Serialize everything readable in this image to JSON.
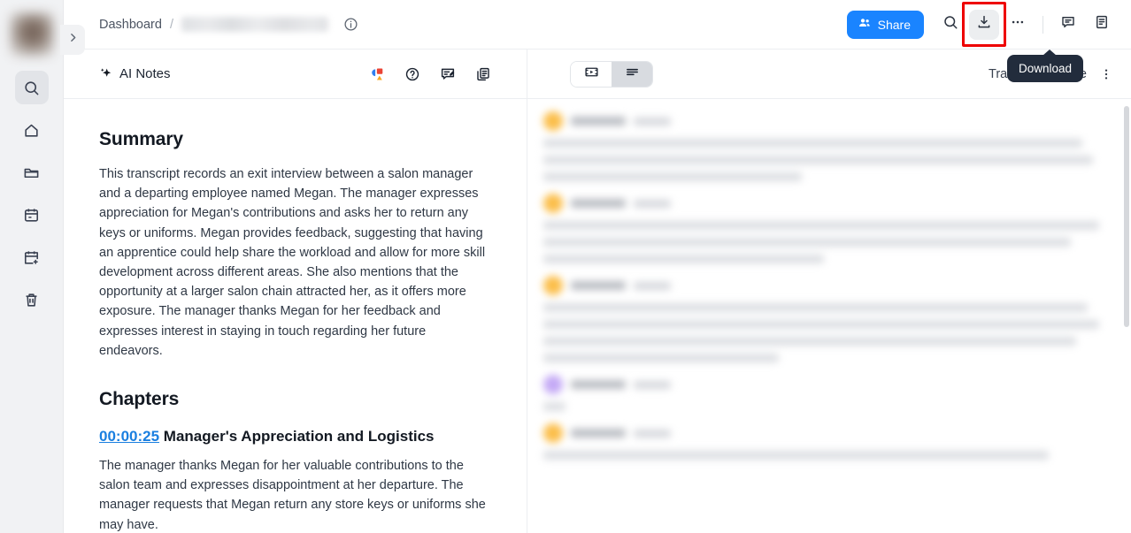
{
  "sidebar": {
    "avatar_label": "user-avatar",
    "items": [
      {
        "name": "search",
        "label": "Search",
        "active": true
      },
      {
        "name": "home",
        "label": "Home",
        "active": false
      },
      {
        "name": "folder",
        "label": "Folder",
        "active": false
      },
      {
        "name": "calendar",
        "label": "Calendar",
        "active": false
      },
      {
        "name": "calendar-add",
        "label": "Schedule",
        "active": false
      },
      {
        "name": "trash",
        "label": "Trash",
        "active": false
      }
    ],
    "expand_icon": "chevron-right-icon"
  },
  "topbar": {
    "breadcrumb_root": "Dashboard",
    "breadcrumb_separator": "/",
    "breadcrumb_current": "",
    "info_icon": "info-circle-icon",
    "share_label": "Share",
    "share_color": "#1a84ff",
    "icons": [
      {
        "name": "search-icon",
        "label": "Search"
      },
      {
        "name": "download-icon",
        "label": "Download",
        "highlighted": true
      },
      {
        "name": "more-horizontal-icon",
        "label": "More options"
      },
      {
        "name": "comment-icon",
        "label": "Comments"
      },
      {
        "name": "notes-icon",
        "label": "Notes"
      }
    ],
    "tooltip": "Download",
    "tooltip_bg": "#222c3c",
    "highlight_color": "#ee0000"
  },
  "notes_panel": {
    "title": "AI Notes",
    "title_icon": "sparkle-icon",
    "actions": [
      {
        "name": "shapes-icon",
        "label": "Templates"
      },
      {
        "name": "help-circle-icon",
        "label": "Help"
      },
      {
        "name": "edit-note-icon",
        "label": "Edit notes"
      },
      {
        "name": "copy-icon",
        "label": "Copy"
      }
    ],
    "summary_heading": "Summary",
    "summary_text": "This transcript records an exit interview between a salon manager and a departing employee named Megan. The manager expresses appreciation for Megan's contributions and asks her to return any keys or uniforms. Megan provides feedback, suggesting that having an apprentice could help share the workload and allow for more skill development across different areas. She also mentions that the opportunity at a larger salon chain attracted her, as it offers more exposure. The manager thanks Megan for her feedback and expresses interest in staying in touch regarding her future endeavors.",
    "chapters_heading": "Chapters",
    "chapters": [
      {
        "timestamp": "00:00:25",
        "title": "Manager's Appreciation and Logistics",
        "body": "The manager thanks Megan for her valuable contributions to the salon team and expresses disappointment at her departure. The manager requests that Megan return any store keys or uniforms she may have.",
        "link_color": "#1a7fe0"
      }
    ]
  },
  "transcript_panel": {
    "view_toggle": [
      {
        "name": "video-view-icon",
        "label": "Video view",
        "selected": false
      },
      {
        "name": "text-view-icon",
        "label": "Text view",
        "selected": true
      }
    ],
    "tab_label": "Transcript",
    "more_label": "More",
    "more_icon": "kebab-menu-icon",
    "entries": [
      {
        "speaker_color": "#fbbe4a",
        "lines": 3,
        "blurred": true
      },
      {
        "speaker_color": "#fbbe4a",
        "lines": 3,
        "blurred": true
      },
      {
        "speaker_color": "#fbbe4a",
        "lines": 4,
        "blurred": true
      },
      {
        "speaker_color": "#c4a9f5",
        "lines": 1,
        "blurred": true
      },
      {
        "speaker_color": "#fbbe4a",
        "lines": 1,
        "blurred": true
      }
    ]
  }
}
